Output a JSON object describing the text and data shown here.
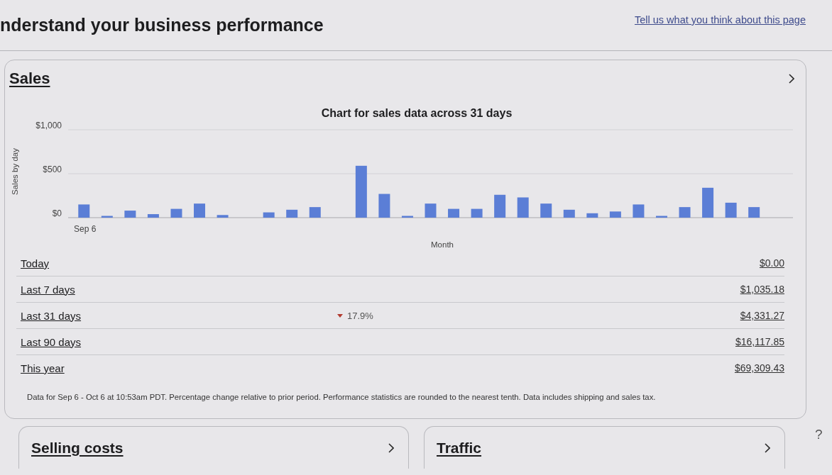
{
  "page": {
    "title": "nderstand your business performance",
    "feedback_link": "Tell us what you think about this page"
  },
  "sales": {
    "title": "Sales",
    "chart_data": {
      "type": "bar",
      "title": "Chart for sales data across 31 days",
      "xlabel": "Month",
      "ylabel": "Sales by day",
      "values": [
        150,
        20,
        80,
        40,
        100,
        160,
        30,
        0,
        60,
        90,
        120,
        0,
        590,
        270,
        20,
        160,
        100,
        100,
        260,
        230,
        160,
        90,
        50,
        70,
        150,
        20,
        120,
        340,
        170,
        120,
        0
      ],
      "ylim": [
        0,
        1000
      ],
      "yticks": [
        {
          "value": 0,
          "label": "$0"
        },
        {
          "value": 500,
          "label": "$500"
        },
        {
          "value": 1000,
          "label": "$1,000"
        }
      ],
      "annotations": [
        "Sep 6"
      ]
    },
    "periods": [
      {
        "label": "Today",
        "value": "$0.00"
      },
      {
        "label": "Last 7 days",
        "value": "$1,035.18"
      },
      {
        "label": "Last 31 days",
        "change": {
          "value": "17.9%",
          "decrease": true
        },
        "value": "$4,331.27"
      },
      {
        "label": "Last 90 days",
        "value": "$16,117.85"
      },
      {
        "label": "This year",
        "value": "$69,309.43"
      }
    ],
    "footnote": "Data for Sep 6 - Oct 6 at 10:53am PDT. Percentage change relative to prior period. Performance statistics are rounded to the nearest tenth. Data includes shipping and sales tax."
  },
  "cards": [
    {
      "title": "Selling costs"
    },
    {
      "title": "Traffic"
    }
  ],
  "help": "?"
}
